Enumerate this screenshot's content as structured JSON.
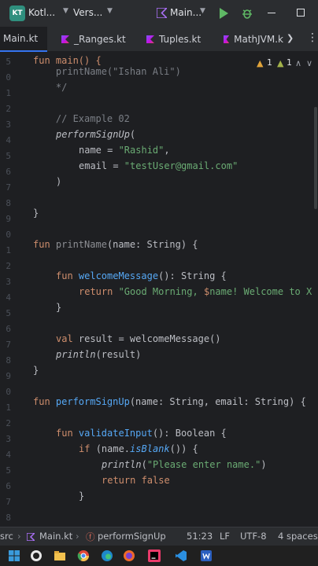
{
  "titlebar": {
    "project_badge": "KT",
    "project_name": "Kotl...",
    "vcs_label": "Vers...",
    "run_config": "Main...",
    "icons": [
      "run-icon",
      "debug-icon",
      "minimize-icon",
      "maximize-icon"
    ]
  },
  "tabs": [
    {
      "label": "Main.kt",
      "active": true
    },
    {
      "label": "_Ranges.kt",
      "active": false
    },
    {
      "label": "Tuples.kt",
      "active": false
    },
    {
      "label": "MathJVM.k",
      "active": false
    }
  ],
  "inspection": {
    "warnings": "1",
    "weak_warnings": "1"
  },
  "gutter": [
    "5",
    "0",
    "1",
    "2",
    "3",
    "4",
    "5",
    "6",
    "7",
    "8",
    "9",
    "0",
    "1",
    "2",
    "3",
    "4",
    "5",
    "6",
    "7",
    "8",
    "9",
    "0",
    "1",
    "2",
    "3",
    "4",
    "5",
    "6",
    "7",
    "8",
    "9"
  ],
  "code": {
    "l0": "fun main() {",
    "l1": "    printName(\"Ishan Ali\")",
    "l2": "    */",
    "l3": "",
    "l4": "    // Example 02",
    "l5a": "performSignUp",
    "l5b": "(",
    "l6a": "name = ",
    "l6b": "\"Rashid\"",
    "l6c": ",",
    "l7a": "email = ",
    "l7b": "\"testUser@gmail.com\"",
    "l8": ")",
    "l10": "}",
    "l12a": "fun ",
    "l12b": "printName",
    "l12c": "(name: String) {",
    "l14a": "fun ",
    "l14b": "welcomeMessage",
    "l14c": "(): String {",
    "l15a": "return ",
    "l15b": "\"Good Morning, ",
    "l15c": "$",
    "l15d": "name! Welcome to X",
    "l16": "}",
    "l18a": "val ",
    "l18b": "result = welcomeMessage()",
    "l19a": "println",
    "l19b": "(result)",
    "l20": "}",
    "l22a": "fun ",
    "l22b": "performSignUp",
    "l22c": "(name: String, email: String) {",
    "l24a": "fun ",
    "l24b": "validateInput",
    "l24c": "(): Boolean {",
    "l25a": "if ",
    "l25b": "(name.",
    "l25c": "isBlank",
    "l25d": "()) {",
    "l26a": "println",
    "l26b": "(",
    "l26c": "\"Please enter name.\"",
    "l26d": ")",
    "l27a": "return ",
    "l27b": "false",
    "l28": "}"
  },
  "statusbar": {
    "src": "src",
    "file": "Main.kt",
    "symbol": "performSignUp",
    "position": "51:23",
    "line_sep": "LF",
    "encoding": "UTF-8",
    "indent": "4 spaces"
  },
  "colors": {
    "keyword": "#cf8e6d",
    "function": "#56a8f5",
    "string": "#6aab73",
    "comment": "#7a7e85",
    "accent": "#3574f0"
  }
}
